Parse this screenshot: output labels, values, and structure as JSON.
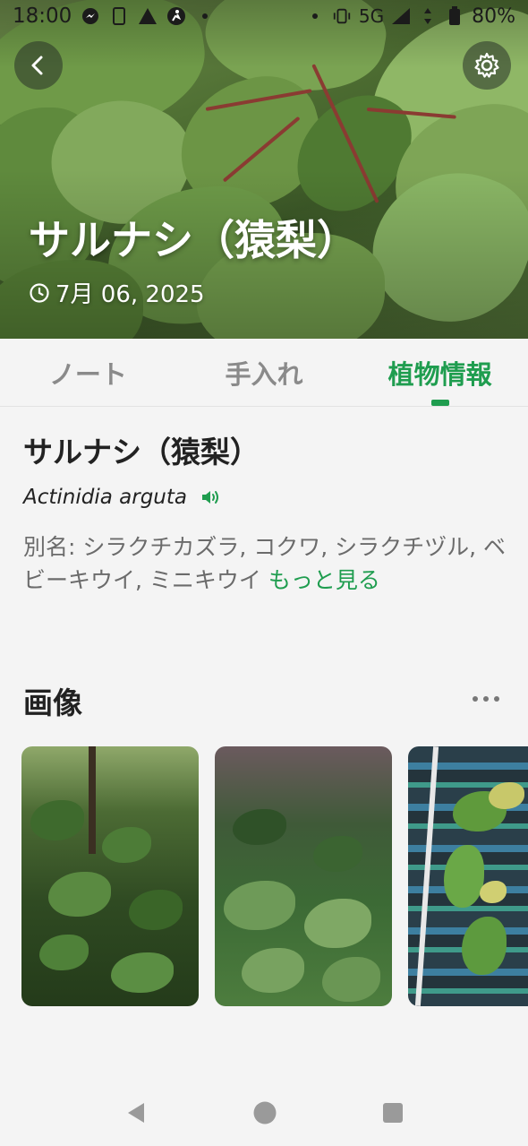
{
  "status_bar": {
    "time": "18:00",
    "network": "5G",
    "battery": "80%"
  },
  "header": {
    "title": "サルナシ（猿梨）",
    "date": "7月 06, 2025"
  },
  "tabs": [
    {
      "label": "ノート"
    },
    {
      "label": "手入れ"
    },
    {
      "label": "植物情報"
    }
  ],
  "plant": {
    "name": "サルナシ（猿梨）",
    "scientific_name": "Actinidia arguta",
    "aliases": "別名: シラクチカズラ, コクワ, シラクチヅル, ベビーキウイ, ミニキウイ",
    "more_label": "もっと見る"
  },
  "images_section": {
    "title": "画像"
  },
  "colors": {
    "accent": "#1f9d4f",
    "text": "#222222",
    "muted": "#6b6b6b"
  },
  "icons": [
    "back-icon",
    "settings-icon",
    "clock-icon",
    "speaker-icon",
    "more-icon",
    "nav-back-icon",
    "nav-home-icon",
    "nav-recents-icon"
  ]
}
